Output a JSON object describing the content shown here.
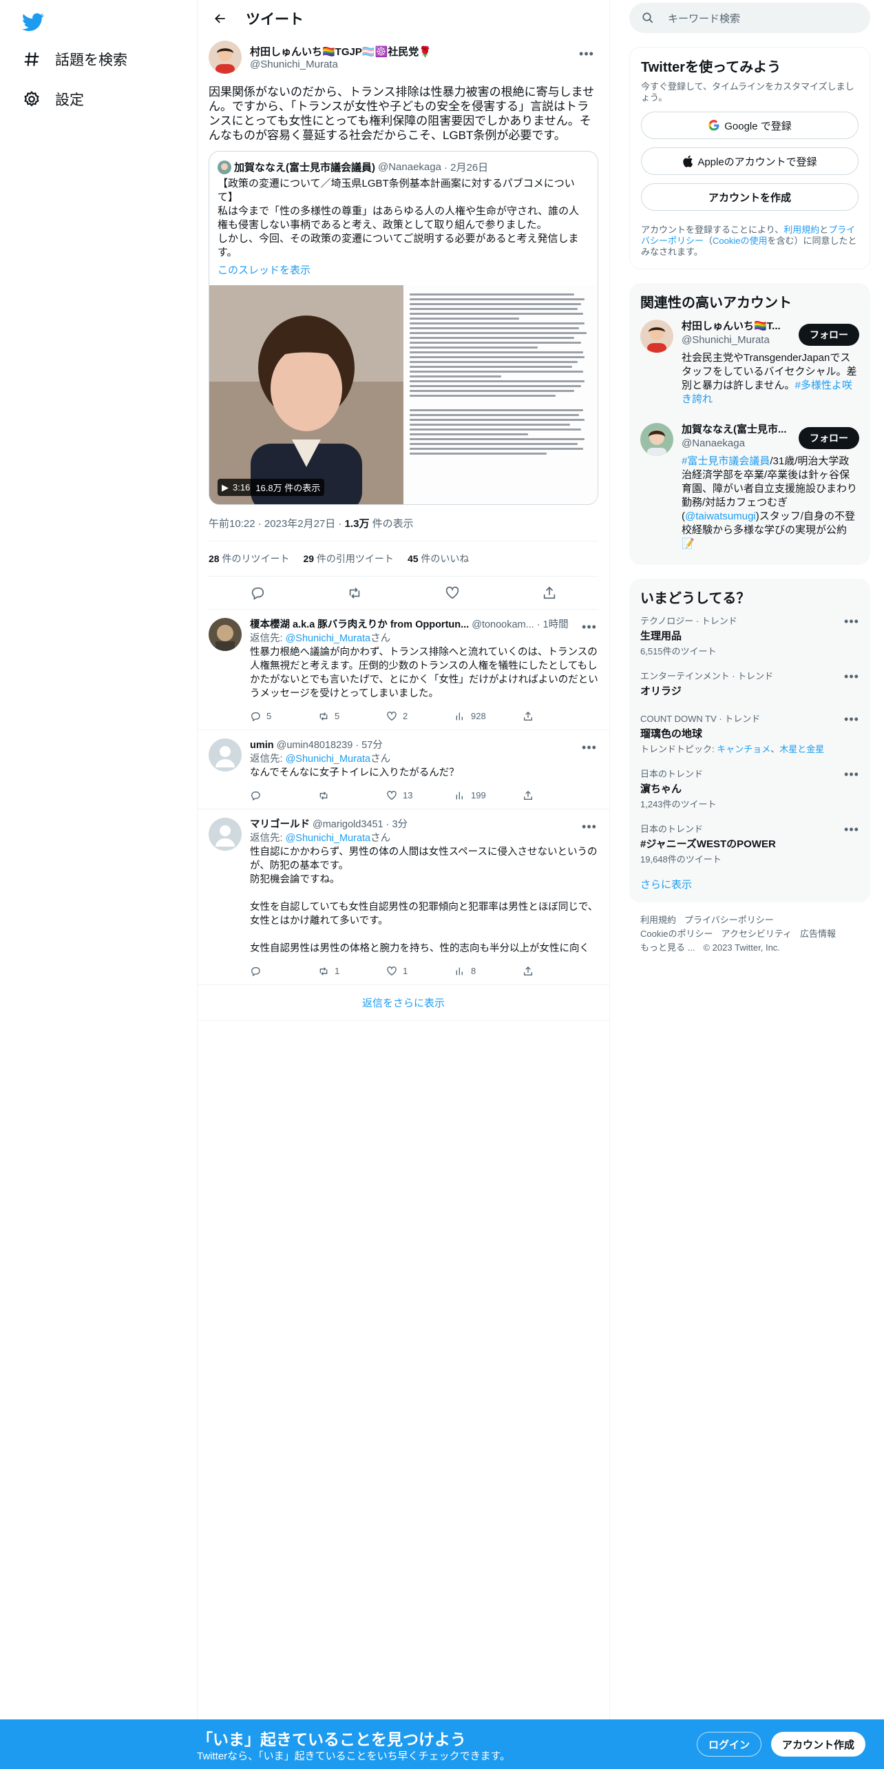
{
  "nav": {
    "explore_label": "話題を検索",
    "settings_label": "設定"
  },
  "header": {
    "title": "ツイート"
  },
  "tweet": {
    "display_name": "村田しゅんいち🏳️‍🌈TGJP🏳️‍⚧️☸️社民党🌹",
    "handle": "@Shunichi_Murata",
    "text": "因果関係がないのだから、トランス排除は性暴力被害の根絶に寄与しません。ですから、「トランスが女性や子どもの安全を侵害する」言説はトランスにとっても女性にとっても権利保障の阻害要因でしかありません。そんなものが容易く蔓延する社会だからこそ、LGBT条例が必要です。",
    "quote": {
      "display_name": "加賀ななえ(富士見市議会議員)",
      "handle": "@Nanaekaga",
      "date": "· 2月26日",
      "text": "【政策の変遷について／埼玉県LGBT条例基本計画案に対するパブコメについて】\n私は今まで「性の多様性の尊重」はあらゆる人の人権や生命が守され、誰の人権も侵害しない事柄であると考え、政策として取り組んで参りました。\nしかし、今回、その政策の変遷についてご説明する必要があると考え発信します。",
      "show_thread": "このスレッドを表示",
      "video_time": "3:16",
      "video_views": "16.8万 件の表示"
    },
    "time": "午前10:22 · 2023年2月27日 · ",
    "views_count": "1.3万",
    "views_label": " 件の表示",
    "retweets_count": "28",
    "retweets_label": " 件のリツイート",
    "quotes_count": "29",
    "quotes_label": " 件の引用ツイート",
    "likes_count": "45",
    "likes_label": " 件のいいね"
  },
  "replies": [
    {
      "display_name": "榎本櫻湖 a.k.a 豚バラ肉えりか from Opportun...",
      "handle": "@tonookam...",
      "time": "· 1時間",
      "reply_prefix": "返信先: ",
      "reply_to": "@Shunichi_Murata",
      "reply_suffix": "さん",
      "text": "性暴力根絶へ議論が向かわず、トランス排除へと流れていくのは、トランスの人権無視だと考えます。圧倒的少数のトランスの人権を犠牲にしたとしてもしかたがないとでも言いたげで、とにかく「女性」だけがよければよいのだというメッセージを受けとってしまいました。",
      "replies": "5",
      "retweets": "5",
      "likes": "2",
      "views": "928"
    },
    {
      "display_name": "umin",
      "handle": "@umin48018239",
      "time": "· 57分",
      "reply_prefix": "返信先: ",
      "reply_to": "@Shunichi_Murata",
      "reply_suffix": "さん",
      "text": "なんでそんなに女子トイレに入りたがるんだ？",
      "replies": "",
      "retweets": "",
      "likes": "13",
      "views": "199"
    },
    {
      "display_name": "マリゴールド",
      "handle": "@marigold3451",
      "time": "· 3分",
      "reply_prefix": "返信先: ",
      "reply_to": "@Shunichi_Murata",
      "reply_suffix": "さん",
      "text": "性自認にかかわらず、男性の体の人間は女性スペースに侵入させないというのが、防犯の基本です。\n防犯機会論ですね。\n\n女性を自認していても女性自認男性の犯罪傾向と犯罪率は男性とほぼ同じで、女性とはかけ離れて多いです。\n\n女性自認男性は男性の体格と腕力を持ち、性的志向も半分以上が女性に向く",
      "replies": "",
      "retweets": "1",
      "likes": "1",
      "views": "8"
    }
  ],
  "show_more_replies": "返信をさらに表示",
  "right": {
    "search_placeholder": "キーワード検索",
    "signup": {
      "title": "Twitterを使ってみよう",
      "subtitle": "今すぐ登録して、タイムラインをカスタマイズしましょう。",
      "google": "Google で登録",
      "apple": "Appleのアカウントで登録",
      "create": "アカウントを作成",
      "legal_1": "アカウントを登録することにより、",
      "legal_terms": "利用規約",
      "legal_2": "と",
      "legal_privacy": "プライバシーポリシー",
      "legal_3": "（",
      "legal_cookie": "Cookieの使用",
      "legal_4": "を含む）に同意したとみなされます。"
    },
    "related": {
      "title": "関連性の高いアカウント",
      "accounts": [
        {
          "display_name": "村田しゅんいち🏳️‍🌈T...",
          "handle": "@Shunichi_Murata",
          "follow": "フォロー",
          "bio": "社会民主党やTransgenderJapanでスタッフをしているバイセクシャル。差別と暴力は許しません。",
          "bio_link": "#多様性よ咲き誇れ"
        },
        {
          "display_name": "加賀ななえ(富士見市...",
          "handle": "@Nanaekaga",
          "follow": "フォロー",
          "bio_link": "#富士見市議会議員",
          "bio": "/31歳/明治大学政治経済学部を卒業/卒業後は針ヶ谷保育園、障がい者自立支援施設ひまわり勤務/対話カフェつむぎ(",
          "bio_link2": "@taiwatsumugi",
          "bio_tail": ")スタッフ/自身の不登校経験から多様な学びの実現が公約📝"
        }
      ]
    },
    "trends": {
      "title": "いまどうしてる？",
      "items": [
        {
          "context": "テクノロジー · トレンド",
          "name": "生理用品",
          "count": "6,515件のツイート"
        },
        {
          "context": "エンターテインメント · トレンド",
          "name": "オリラジ",
          "count": ""
        },
        {
          "context": "COUNT DOWN TV · トレンド",
          "name": "瑠璃色の地球",
          "count": "トレンドトピック: ",
          "topic_1": "キャンチョメ",
          "topic_sep": "、",
          "topic_2": "木星と金星"
        },
        {
          "context": "日本のトレンド",
          "name": "濵ちゃん",
          "count": "1,243件のツイート"
        },
        {
          "context": "日本のトレンド",
          "name": "#ジャニーズWESTのPOWER",
          "count": "19,648件のツイート"
        }
      ],
      "show_more": "さらに表示"
    },
    "footer": {
      "terms": "利用規約",
      "privacy": "プライバシーポリシー",
      "cookie": "Cookieのポリシー",
      "accessibility": "アクセシビリティ",
      "ads": "広告情報",
      "more": "もっと見る ...",
      "copyright": "© 2023 Twitter, Inc."
    }
  },
  "bottom_bar": {
    "title": "「いま」起きていることを見つけよう",
    "subtitle": "Twitterなら、「いま」起きていることをいち早くチェックできます。",
    "login": "ログイン",
    "signup": "アカウント作成"
  },
  "colors": {
    "accent": "#1d9bf0",
    "text": "#0f1419",
    "muted": "#536471"
  }
}
